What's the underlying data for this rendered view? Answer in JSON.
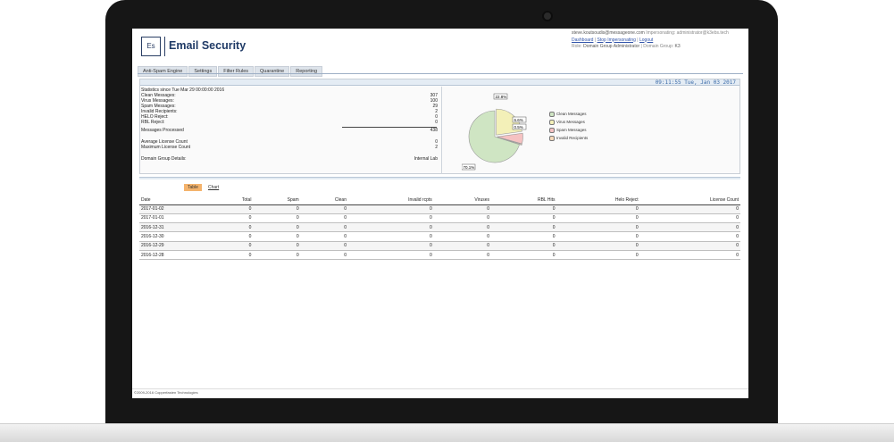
{
  "app": {
    "logo_mark": "Es",
    "title": "Email Security"
  },
  "user": {
    "email": "steve.koutsoudis@messageone.com",
    "impersonating_label": "Impersonating:",
    "impersonating_value": "administrator@k3ebs.tech",
    "links": [
      "Dashboard",
      "Stop Impersonating",
      "Logout"
    ],
    "role_label": "Role:",
    "role_value": "Domain Group Administrator",
    "domain_group_label": "Domain Group:",
    "domain_group_value": "K3"
  },
  "tabs": [
    "Anti-Spam Engine",
    "Settings",
    "Filter Rules",
    "Quarantine",
    "Reporting"
  ],
  "clock": "09:11:55 Tue, Jan 03 2017",
  "stats": {
    "since": "Statistics since Tue Mar 29 00:00:00 2016",
    "rows": [
      {
        "label": "Clean Messages:",
        "value": "307"
      },
      {
        "label": "Virus Messages:",
        "value": "100"
      },
      {
        "label": "Spam Messages:",
        "value": "29"
      },
      {
        "label": "Invalid Recipients:",
        "value": "2"
      },
      {
        "label": "HELO Reject:",
        "value": "0"
      },
      {
        "label": "RBL Reject:",
        "value": "0"
      }
    ],
    "processed_label": "Messages Processed",
    "processed_value": "438",
    "avg_license_label": "Average License Count",
    "avg_license_value": "0",
    "max_license_label": "Maximum License Count",
    "max_license_value": "2",
    "domain_group_label": "Domain Group Details:",
    "domain_group_value": "Internal Lab"
  },
  "pie": {
    "slices": [
      {
        "name": "Clean Messages",
        "percent": 70.1,
        "label": "70.1%",
        "color": "#cfe5c3"
      },
      {
        "name": "Virus Messages",
        "percent": 22.8,
        "label": "22.8%",
        "color": "#f3f0b8"
      },
      {
        "name": "Spam Messages",
        "percent": 6.6,
        "label": "6.6%",
        "color": "#f5c2c2"
      },
      {
        "name": "Invalid Recipients",
        "percent": 0.5,
        "label": "0.5%",
        "color": "#f7d9b8"
      }
    ],
    "legend": [
      "Clean Messages",
      "Virus Messages",
      "Spam Messages",
      "Invalid Recipients"
    ]
  },
  "view_tabs": {
    "table": "Table",
    "chart": "Chart"
  },
  "table": {
    "headers": [
      "Date",
      "Total",
      "Spam",
      "Clean",
      "Invalid rcpts",
      "Viruses",
      "RBL Hits",
      "Helo Reject",
      "License Count"
    ],
    "rows": [
      [
        "2017-01-02",
        "0",
        "0",
        "0",
        "0",
        "0",
        "0",
        "0",
        "0"
      ],
      [
        "2017-01-01",
        "0",
        "0",
        "0",
        "0",
        "0",
        "0",
        "0",
        "0"
      ],
      [
        "2016-12-31",
        "0",
        "0",
        "0",
        "0",
        "0",
        "0",
        "0",
        "0"
      ],
      [
        "2016-12-30",
        "0",
        "0",
        "0",
        "0",
        "0",
        "0",
        "0",
        "0"
      ],
      [
        "2016-12-29",
        "0",
        "0",
        "0",
        "0",
        "0",
        "0",
        "0",
        "0"
      ],
      [
        "2016-12-28",
        "0",
        "0",
        "0",
        "0",
        "0",
        "0",
        "0",
        "0"
      ]
    ]
  },
  "footer": "©2009-2016 Copperfasten Technologies"
}
